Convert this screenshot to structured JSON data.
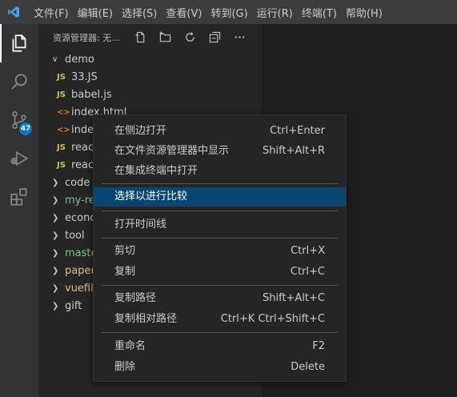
{
  "menubar": {
    "items": [
      "文件(F)",
      "编辑(E)",
      "选择(S)",
      "查看(V)",
      "转到(G)",
      "运行(R)",
      "终端(T)",
      "帮助(H)"
    ]
  },
  "activity": {
    "source_control_badge": "47"
  },
  "explorer": {
    "title": "资源管理器: 无...",
    "root": "demo",
    "files": [
      {
        "icon": "JS",
        "name": "33.JS"
      },
      {
        "icon": "JS",
        "name": "babel.js"
      },
      {
        "icon": "<>",
        "name": "index.html"
      },
      {
        "icon": "<>",
        "name": "index"
      },
      {
        "icon": "JS",
        "name": "react"
      },
      {
        "icon": "JS",
        "name": "react"
      }
    ],
    "folders": [
      {
        "name": "code",
        "color": "#cccccc"
      },
      {
        "name": "my-re",
        "color": "#73c991"
      },
      {
        "name": "econo",
        "color": "#cccccc"
      },
      {
        "name": "tool",
        "color": "#cccccc"
      },
      {
        "name": "maste",
        "color": "#73c991"
      },
      {
        "name": "paper",
        "color": "#e2c08d"
      },
      {
        "name": "vuefile",
        "color": "#e2c08d"
      },
      {
        "name": "gift",
        "color": "#cccccc"
      }
    ]
  },
  "context_menu": {
    "items": [
      {
        "label": "在侧边打开",
        "shortcut": "Ctrl+Enter"
      },
      {
        "label": "在文件资源管理器中显示",
        "shortcut": "Shift+Alt+R"
      },
      {
        "label": "在集成终端中打开",
        "shortcut": ""
      },
      {
        "label": "选择以进行比较",
        "shortcut": ""
      },
      {
        "label": "打开时间线",
        "shortcut": ""
      },
      {
        "label": "剪切",
        "shortcut": "Ctrl+X"
      },
      {
        "label": "复制",
        "shortcut": "Ctrl+C"
      },
      {
        "label": "复制路径",
        "shortcut": "Shift+Alt+C"
      },
      {
        "label": "复制相对路径",
        "shortcut": "Ctrl+K Ctrl+Shift+C"
      },
      {
        "label": "重命名",
        "shortcut": "F2"
      },
      {
        "label": "删除",
        "shortcut": "Delete"
      }
    ]
  },
  "colors": {
    "accent": "#007acc",
    "selection": "#094771",
    "js_icon": "#cbcb41",
    "html_icon": "#e37933"
  }
}
